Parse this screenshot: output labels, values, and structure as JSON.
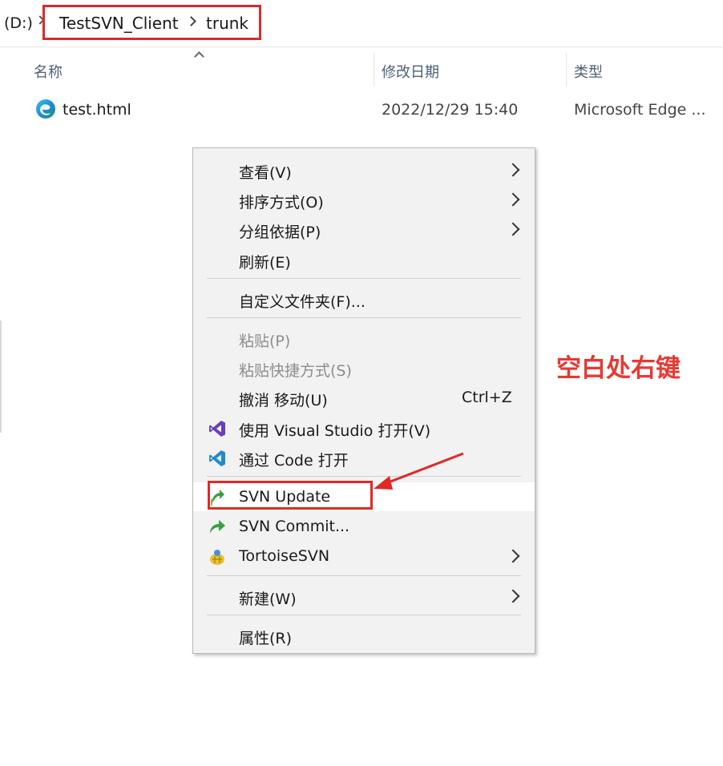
{
  "address": {
    "drive": "(D:)",
    "crumbs": [
      "TestSVN_Client",
      "trunk"
    ]
  },
  "columns": {
    "name": "名称",
    "date": "修改日期",
    "type": "类型"
  },
  "file": {
    "name": "test.html",
    "date": "2022/12/29 15:40",
    "type": "Microsoft Edge ..."
  },
  "menu": {
    "items": [
      {
        "label": "查看(V)"
      },
      {
        "label": "排序方式(O)"
      },
      {
        "label": "分组依据(P)"
      },
      {
        "label": "刷新(E)"
      },
      {
        "label": "自定义文件夹(F)..."
      },
      {
        "label": "粘贴(P)"
      },
      {
        "label": "粘贴快捷方式(S)"
      },
      {
        "label": "撤消 移动(U)",
        "shortcut": "Ctrl+Z"
      },
      {
        "label": "使用 Visual Studio 打开(V)"
      },
      {
        "label": "通过 Code 打开"
      },
      {
        "label": "SVN Update"
      },
      {
        "label": "SVN Commit..."
      },
      {
        "label": "TortoiseSVN"
      },
      {
        "label": "新建(W)"
      },
      {
        "label": "属性(R)"
      }
    ]
  },
  "annotation": "空白处右键",
  "colors": {
    "highlight_red": "#e02828",
    "annotation_red": "#e53a34",
    "menu_bg": "#f2f2f2"
  }
}
